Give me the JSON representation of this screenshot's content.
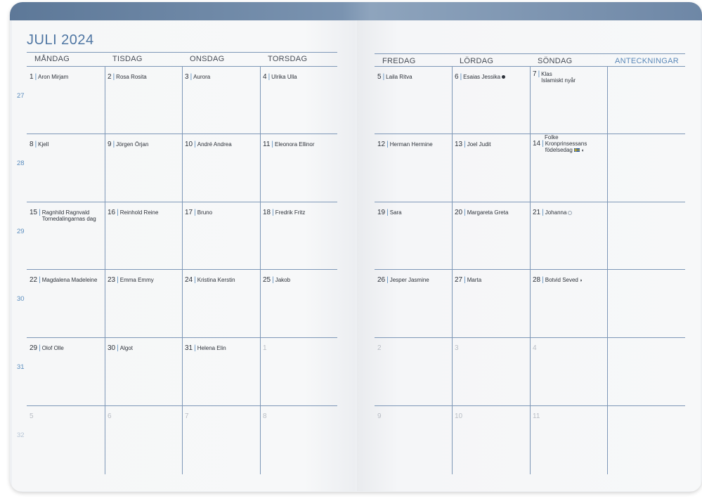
{
  "title": "JULI 2024",
  "left_headers": [
    "MÅNDAG",
    "TISDAG",
    "ONSDAG",
    "TORSDAG"
  ],
  "right_headers": [
    "FREDAG",
    "LÖRDAG",
    "SÖNDAG",
    "ANTECKNINGAR"
  ],
  "weeks": [
    "27",
    "28",
    "29",
    "30",
    "31",
    "32"
  ],
  "rows": [
    {
      "left": [
        {
          "num": "1",
          "text": "Aron Mirjam"
        },
        {
          "num": "2",
          "text": "Rosa Rosita"
        },
        {
          "num": "3",
          "text": "Aurora"
        },
        {
          "num": "4",
          "text": "Ulrika Ulla"
        }
      ],
      "right": [
        {
          "num": "5",
          "text": "Laila Ritva"
        },
        {
          "num": "6",
          "text": "Esaias Jessika",
          "icon": "new-moon-icon"
        },
        {
          "num": "7",
          "text": "Klas",
          "text2": "Islamiskt nyår"
        }
      ]
    },
    {
      "left": [
        {
          "num": "8",
          "text": "Kjell"
        },
        {
          "num": "9",
          "text": "Jörgen Örjan"
        },
        {
          "num": "10",
          "text": "André Andrea"
        },
        {
          "num": "11",
          "text": "Eleonora Ellinor"
        }
      ],
      "right": [
        {
          "num": "12",
          "text": "Herman Hermine"
        },
        {
          "num": "13",
          "text": "Joel Judit"
        },
        {
          "num": "14",
          "text0": "Folke",
          "text": "Kronprinsessans",
          "text2": "födelsedag",
          "icon": "swedish-flag-icon"
        }
      ]
    },
    {
      "left": [
        {
          "num": "15",
          "text": "Ragnhild Ragnvald",
          "text2": "Tornedalingarnas dag"
        },
        {
          "num": "16",
          "text": "Reinhold Reine"
        },
        {
          "num": "17",
          "text": "Bruno"
        },
        {
          "num": "18",
          "text": "Fredrik Fritz"
        }
      ],
      "right": [
        {
          "num": "19",
          "text": "Sara"
        },
        {
          "num": "20",
          "text": "Margareta Greta"
        },
        {
          "num": "21",
          "text": "Johanna",
          "icon": "full-moon-icon"
        }
      ]
    },
    {
      "left": [
        {
          "num": "22",
          "text": "Magdalena Madeleine"
        },
        {
          "num": "23",
          "text": "Emma Emmy"
        },
        {
          "num": "24",
          "text": "Kristina Kerstin"
        },
        {
          "num": "25",
          "text": "Jakob"
        }
      ],
      "right": [
        {
          "num": "26",
          "text": "Jesper Jasmine"
        },
        {
          "num": "27",
          "text": "Marta"
        },
        {
          "num": "28",
          "text": "Botvid Seved",
          "icon": "last-quarter-moon-icon"
        }
      ]
    },
    {
      "left": [
        {
          "num": "29",
          "text": "Olof Olle"
        },
        {
          "num": "30",
          "text": "Algot"
        },
        {
          "num": "31",
          "text": "Helena Elin"
        },
        {
          "num": "1",
          "dim": true
        }
      ],
      "right": [
        {
          "num": "2",
          "dim": true
        },
        {
          "num": "3",
          "dim": true
        },
        {
          "num": "4",
          "dim": true
        }
      ]
    },
    {
      "left": [
        {
          "num": "5",
          "dim": true
        },
        {
          "num": "6",
          "dim": true
        },
        {
          "num": "7",
          "dim": true
        },
        {
          "num": "8",
          "dim": true
        }
      ],
      "right": [
        {
          "num": "9",
          "dim": true
        },
        {
          "num": "10",
          "dim": true
        },
        {
          "num": "11",
          "dim": true
        }
      ]
    }
  ]
}
